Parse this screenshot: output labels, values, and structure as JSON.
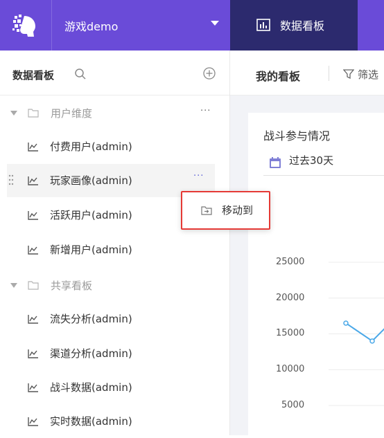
{
  "header": {
    "project_name": "游戏demo",
    "active_tab": "数据看板",
    "colors": {
      "bar": "#6a4bd8",
      "active_tab": "#2c2a6e"
    }
  },
  "sidebar": {
    "title": "数据看板",
    "folders": [
      {
        "label": "用户维度",
        "more": "···",
        "items": [
          "付费用户(admin)",
          "玩家画像(admin)",
          "活跃用户(admin)",
          "新增用户(admin)"
        ]
      },
      {
        "label": "共享看板",
        "items": [
          "流失分析(admin)",
          "渠道分析(admin)",
          "战斗数据(admin)",
          "实时数据(admin)"
        ]
      }
    ],
    "hovered_item_more": "···"
  },
  "context_menu": {
    "move_to": "移动到"
  },
  "main": {
    "title": "我的看板",
    "filter_label": "筛选",
    "card": {
      "title": "战斗参与情况",
      "date_range": "过去30天"
    }
  },
  "chart_data": {
    "type": "line",
    "title": "战斗参与情况",
    "yticks": [
      "25000",
      "20000",
      "15000",
      "10000",
      "5000"
    ],
    "ylim": [
      0,
      25000
    ],
    "series": [
      {
        "values": [
          16500,
          14000,
          18000
        ]
      }
    ],
    "color": "#4aa8e8"
  }
}
